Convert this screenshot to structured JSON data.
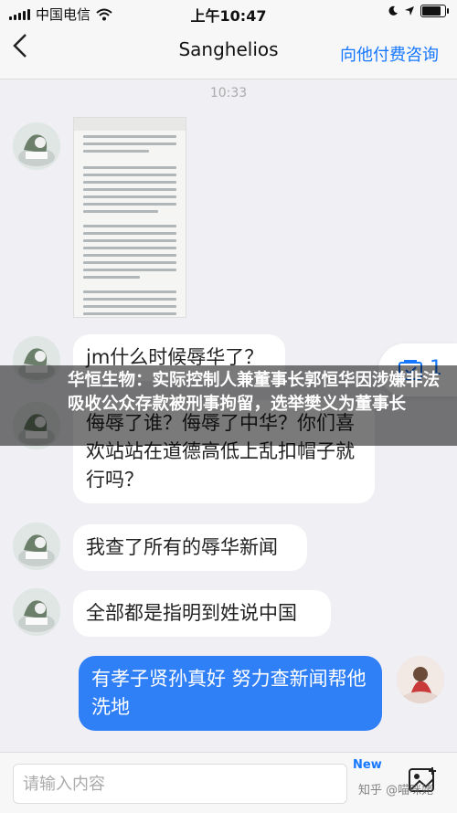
{
  "status_bar": {
    "carrier": "中国电信",
    "time": "上午10:47",
    "battery_level": 0.9
  },
  "nav": {
    "back_icon": "chevron-left-icon",
    "title": "Sanghelios",
    "paid_consult": "向他付费咨询"
  },
  "timestamp": "10:33",
  "messages": [
    {
      "from": "other",
      "type": "image"
    },
    {
      "from": "other",
      "type": "text",
      "text": "jm什么时候辱华了？"
    },
    {
      "from": "other",
      "type": "text",
      "text": "侮辱了谁？侮辱了中华？你们喜欢站站在道德高低上乱扣帽子就行吗？"
    },
    {
      "from": "other",
      "type": "text",
      "text": "我查了所有的辱华新闻"
    },
    {
      "from": "other",
      "type": "text",
      "text": "全部都是指明到姓说中国"
    },
    {
      "from": "me",
      "type": "text",
      "text": "有孝子贤孙真好 努力查新闻帮他洗地"
    }
  ],
  "float_panel": {
    "icon": "mail-check-icon",
    "count": "1"
  },
  "news_overlay": "华恒生物：实际控制人兼董事长郭恒华因涉嫌非法吸收公众存款被刑事拘留，选举樊义为董事长",
  "input": {
    "placeholder": "请输入内容"
  },
  "bottom": {
    "new_badge": "New",
    "image_icon": "image-add-icon",
    "watermark": "知乎 @喵咪姥"
  },
  "colors": {
    "accent": "#1677ff",
    "my_bubble": "#2f7ff7",
    "background": "#efeff4"
  }
}
